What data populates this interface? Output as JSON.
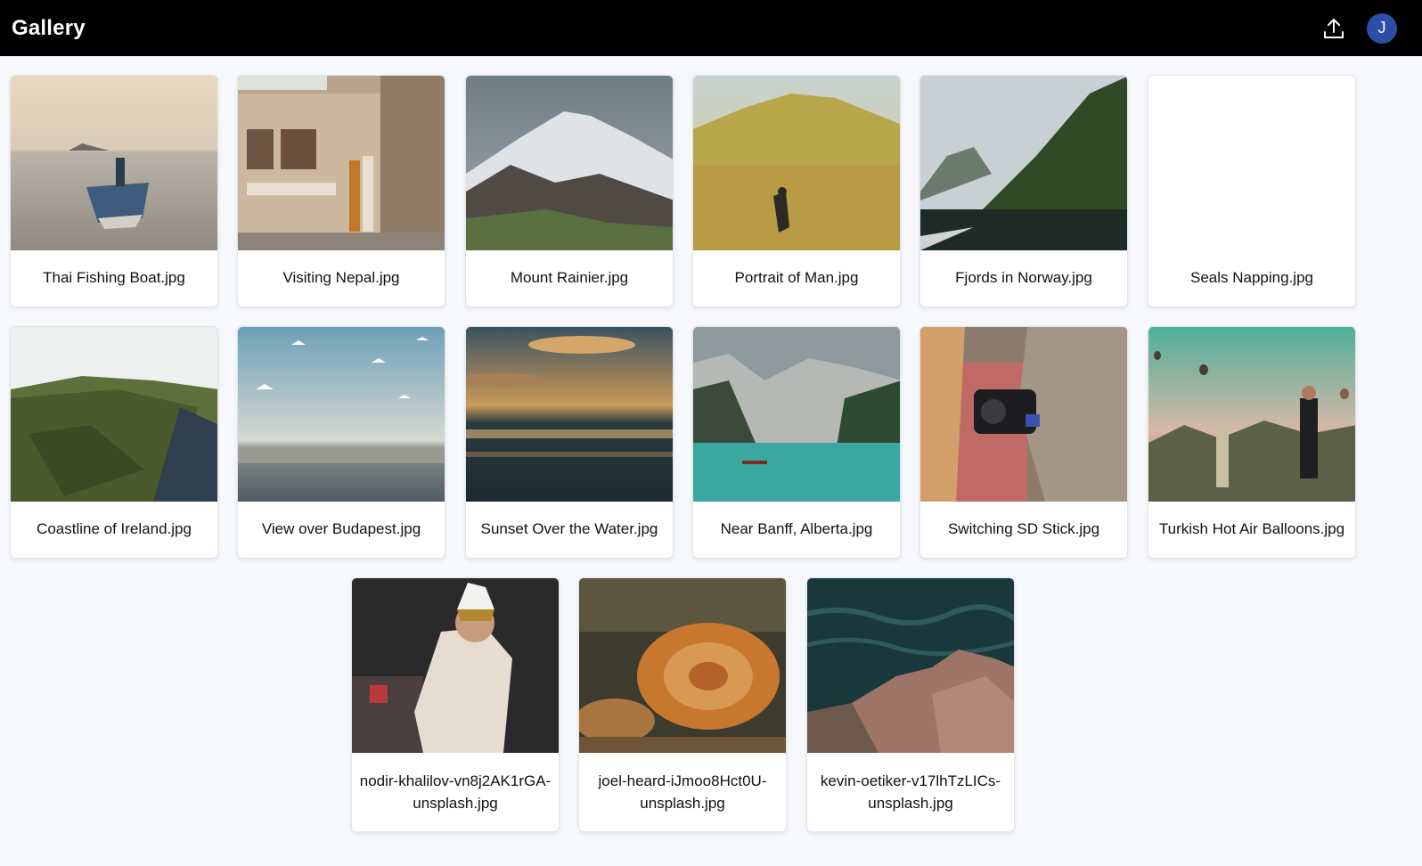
{
  "header": {
    "title": "Gallery",
    "upload_icon": "upload-icon",
    "avatar_initial": "J",
    "avatar_color": "#2d4ea6"
  },
  "gallery": {
    "items": [
      {
        "name": "Thai Fishing Boat.jpg"
      },
      {
        "name": "Visiting Nepal.jpg"
      },
      {
        "name": "Mount Rainier.jpg"
      },
      {
        "name": "Portrait of Man.jpg"
      },
      {
        "name": "Fjords in Norway.jpg"
      },
      {
        "name": "Seals Napping.jpg"
      },
      {
        "name": "Coastline of Ireland.jpg"
      },
      {
        "name": "View over Budapest.jpg"
      },
      {
        "name": "Sunset Over the Water.jpg"
      },
      {
        "name": "Near Banff, Alberta.jpg"
      },
      {
        "name": "Switching SD Stick.jpg"
      },
      {
        "name": "Turkish Hot Air Balloons.jpg"
      },
      {
        "name": "nodir-khalilov-vn8j2AK1rGA-unsplash.jpg"
      },
      {
        "name": "joel-heard-iJmoo8Hct0U-unsplash.jpg"
      },
      {
        "name": "kevin-oetiker-v17lhTzLICs-unsplash.jpg"
      }
    ]
  }
}
